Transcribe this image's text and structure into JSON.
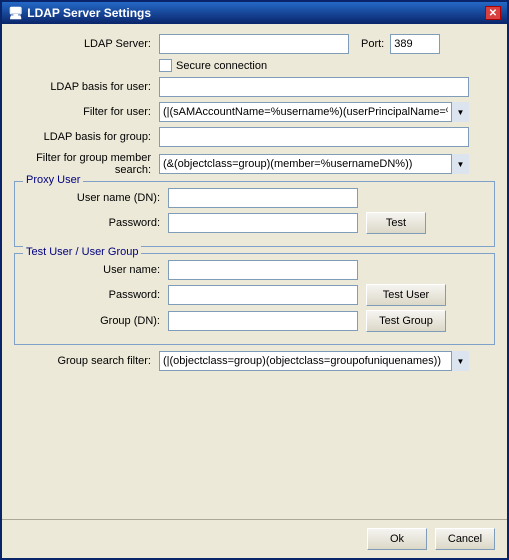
{
  "window": {
    "title": "LDAP Server Settings",
    "close_btn": "✕"
  },
  "form": {
    "ldap_server_label": "LDAP Server:",
    "ldap_server_value": "",
    "port_label": "Port:",
    "port_value": "389",
    "secure_label": "Secure connection",
    "ldap_basis_user_label": "LDAP basis for user:",
    "ldap_basis_user_value": "",
    "filter_user_label": "Filter for user:",
    "filter_user_value": "(|(sAMAccountName=%username%)(userPrincipalName=%",
    "ldap_basis_group_label": "LDAP basis for group:",
    "ldap_basis_group_value": "",
    "filter_group_label": "Filter for group member search:",
    "filter_group_value": "(&(objectclass=group)(member=%usernameDN%))",
    "proxy_user_section": "Proxy User",
    "proxy_username_label": "User name (DN):",
    "proxy_username_value": "",
    "proxy_password_label": "Password:",
    "proxy_password_value": "",
    "proxy_test_btn": "Test",
    "test_section": "Test User / User Group",
    "test_username_label": "User name:",
    "test_username_value": "",
    "test_password_label": "Password:",
    "test_password_value": "",
    "test_user_btn": "Test User",
    "test_group_label": "Group (DN):",
    "test_group_value": "",
    "test_group_btn": "Test Group",
    "group_search_label": "Group search filter:",
    "group_search_value": "(|(objectclass=group)(objectclass=groupofuniquenames))",
    "ok_btn": "Ok",
    "cancel_btn": "Cancel"
  }
}
